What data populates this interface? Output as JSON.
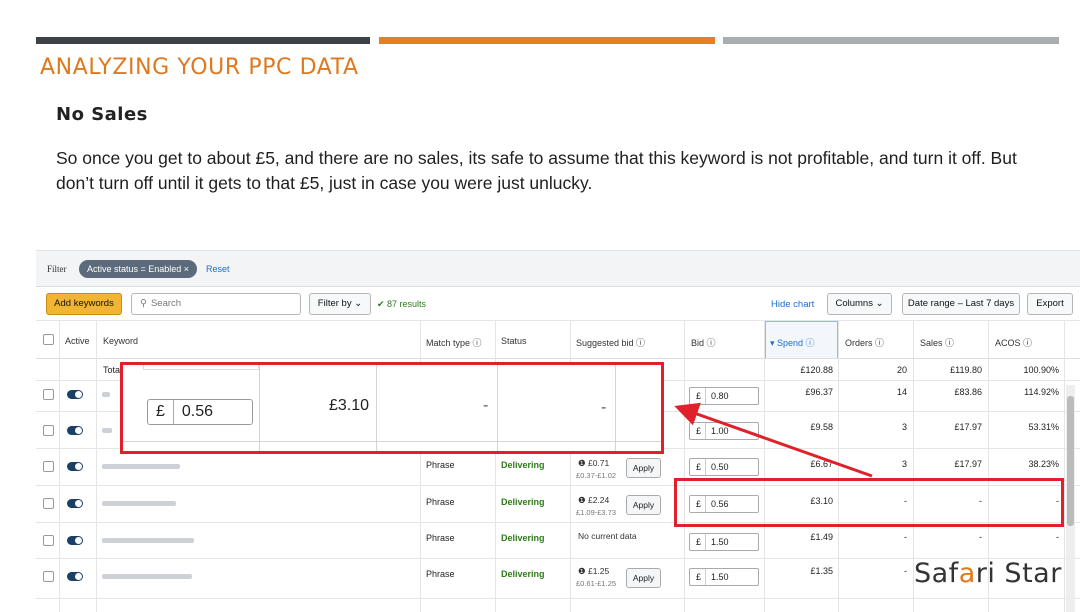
{
  "slide": {
    "title": "ANALYZING YOUR PPC DATA",
    "subtitle": "No Sales",
    "body": "So once you get to about £5, and there are no sales, its safe to assume that this keyword is not  profitable, and turn it off. But don’t turn off until it gets to that £5, just in case you were just unlucky.",
    "accent_colors": [
      "#3c4248",
      "#e87f1e",
      "#a9aeb3"
    ]
  },
  "filter": {
    "label": "Filter",
    "chip": "Active status = Enabled ×",
    "reset": "Reset"
  },
  "toolbar": {
    "add_keywords": "Add keywords",
    "search_placeholder": "Search",
    "filter_by": "Filter by ⌄",
    "results": "✔ 87 results",
    "hide_chart": "Hide chart",
    "columns": "Columns ⌄",
    "date_range": "Date range – Last 7 days",
    "export": "Export"
  },
  "columns": {
    "active": "Active",
    "keyword": "Keyword",
    "match_type": "Match type ⓘ",
    "status": "Status",
    "suggested_bid": "Suggested bid ⓘ",
    "bid": "Bid ⓘ",
    "spend": "▾ Spend ⓘ",
    "orders": "Orders ⓘ",
    "sales": "Sales ⓘ",
    "acos": "ACOS ⓘ"
  },
  "totals": {
    "label": "Tota",
    "spend": "£120.88",
    "orders": "20",
    "sales": "£119.80",
    "acos": "100.90%"
  },
  "rows": [
    {
      "match": "",
      "status": "",
      "sugg": "",
      "range": "",
      "apply": "",
      "bid_cur": "£",
      "bid": "0.80",
      "spend": "£96.37",
      "orders": "14",
      "sales": "£83.86",
      "acos": "114.92%"
    },
    {
      "match": "",
      "status": "",
      "sugg": "",
      "range": "",
      "apply": "",
      "bid_cur": "£",
      "bid": "1.00",
      "spend": "£9.58",
      "orders": "3",
      "sales": "£17.97",
      "acos": "53.31%"
    },
    {
      "match": "Phrase",
      "status": "Delivering",
      "sugg": "❶  £0.71",
      "range": "£0.37-£1.02",
      "apply": "Apply",
      "bid_cur": "£",
      "bid": "0.50",
      "spend": "£6.67",
      "orders": "3",
      "sales": "£17.97",
      "acos": "38.23%"
    },
    {
      "match": "Phrase",
      "status": "Delivering",
      "sugg": "❶  £2.24",
      "range": "£1.09-£3.73",
      "apply": "Apply",
      "bid_cur": "£",
      "bid": "0.56",
      "spend": "£3.10",
      "orders": "-",
      "sales": "-",
      "acos": "-"
    },
    {
      "match": "Phrase",
      "status": "Delivering",
      "sugg": "No current data",
      "range": "",
      "apply": "",
      "bid_cur": "£",
      "bid": "1.50",
      "spend": "£1.49",
      "orders": "-",
      "sales": "-",
      "acos": "-"
    },
    {
      "match": "Phrase",
      "status": "Delivering",
      "sugg": "❶  £1.25",
      "range": "£0.61-£1.25",
      "apply": "Apply",
      "bid_cur": "£",
      "bid": "1.50",
      "spend": "£1.35",
      "orders": "-",
      "sales": "",
      "acos": ""
    }
  ],
  "zoom": {
    "bid_cur": "£",
    "bid": "0.56",
    "spend": "£3.10",
    "orders": "-",
    "sales": "-"
  },
  "logo": {
    "part1": "Saf",
    "part2": "a",
    "part3": "ri Star"
  },
  "icons": [
    "checkbox-icon",
    "toggle-icon",
    "search-icon",
    "chevron-down-icon",
    "info-icon",
    "check-icon",
    "arrow-icon"
  ],
  "highlight_color": "#e0202a"
}
